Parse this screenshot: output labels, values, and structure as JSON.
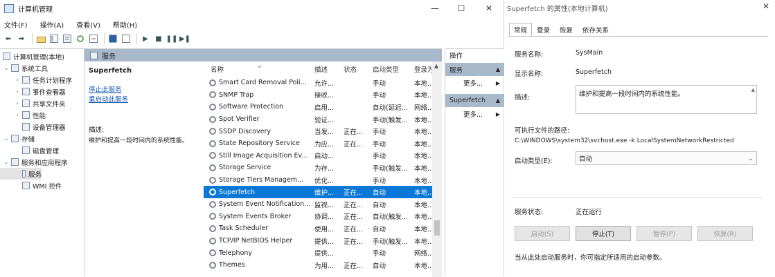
{
  "window": {
    "title": "计算机管理",
    "minimize": "—",
    "maximize": "☐",
    "close": "✕"
  },
  "menu": [
    "文件(F)",
    "操作(A)",
    "查看(V)",
    "帮助(H)"
  ],
  "toolbar": {
    "back": "⬅",
    "forward": "➡",
    "play": "▶",
    "stop": "■",
    "pause": "❚❚",
    "restart": "▶❚"
  },
  "tree": {
    "items": [
      {
        "label": "计算机管理(本地)",
        "arrow": "",
        "indent": 0
      },
      {
        "label": "系统工具",
        "arrow": "⌄",
        "indent": 1
      },
      {
        "label": "任务计划程序",
        "arrow": "›",
        "indent": 2
      },
      {
        "label": "事件查看器",
        "arrow": "›",
        "indent": 2
      },
      {
        "label": "共享文件夹",
        "arrow": "›",
        "indent": 2
      },
      {
        "label": "性能",
        "arrow": "›",
        "indent": 2
      },
      {
        "label": "设备管理器",
        "arrow": "",
        "indent": 2
      },
      {
        "label": "存储",
        "arrow": "⌄",
        "indent": 1
      },
      {
        "label": "磁盘管理",
        "arrow": "",
        "indent": 2
      },
      {
        "label": "服务和应用程序",
        "arrow": "⌄",
        "indent": 1
      },
      {
        "label": "服务",
        "arrow": "",
        "indent": 2
      },
      {
        "label": "WMI 控件",
        "arrow": "",
        "indent": 2
      }
    ]
  },
  "center": {
    "header": "服务",
    "selected_service": "Superfetch",
    "link_stop": "停止此服务",
    "link_restart": "重启动此服务",
    "desc_label": "描述:",
    "desc_text": "维护和提高一段时间内的系统性能。"
  },
  "grid": {
    "columns": [
      "名称",
      "描述",
      "状态",
      "启动类型",
      "登录为"
    ],
    "sort_arrow": "^",
    "rows": [
      [
        "Smart Card Removal Poli...",
        "允许...",
        "",
        "手动",
        "本地..."
      ],
      [
        "SNMP Trap",
        "接收...",
        "",
        "手动",
        "本地..."
      ],
      [
        "Software Protection",
        "启用...",
        "",
        "自动(延迟...",
        "网络..."
      ],
      [
        "Spot Verifier",
        "验证...",
        "",
        "手动(触发...",
        "本地..."
      ],
      [
        "SSDP Discovery",
        "当发...",
        "正在...",
        "手动",
        "本地..."
      ],
      [
        "State Repository Service",
        "为应...",
        "正在...",
        "手动",
        "本地..."
      ],
      [
        "Still Image Acquisition Ev...",
        "启动...",
        "",
        "手动",
        "本地..."
      ],
      [
        "Storage Service",
        "为存...",
        "",
        "手动(触发...",
        "本地..."
      ],
      [
        "Storage Tiers Managem...",
        "优化...",
        "",
        "手动",
        "本地..."
      ],
      [
        "Superfetch",
        "维护...",
        "正在...",
        "自动",
        "本地..."
      ],
      [
        "System Event Notification...",
        "监视...",
        "正在...",
        "自动",
        "本地..."
      ],
      [
        "System Events Broker",
        "协调...",
        "正在...",
        "自动(触发...",
        "本地..."
      ],
      [
        "Task Scheduler",
        "使用...",
        "正在...",
        "自动",
        "本地..."
      ],
      [
        "TCP/IP NetBIOS Helper",
        "提供...",
        "正在...",
        "手动(触发...",
        "本地..."
      ],
      [
        "Telephony",
        "提供...",
        "",
        "手动",
        "网络..."
      ],
      [
        "Themes",
        "为用...",
        "正在...",
        "自动",
        "本地..."
      ]
    ],
    "selected_index": 9
  },
  "actions": {
    "title": "操作",
    "section1": "服务",
    "section2": "Superfetch",
    "more": "更多...",
    "up": "▲",
    "right": "▶"
  },
  "props": {
    "title": "Superfetch 的属性(本地计算机)",
    "close": "✕",
    "tabs": [
      "常规",
      "登录",
      "恢复",
      "依存关系"
    ],
    "service_name_label": "服务名称:",
    "service_name": "SysMain",
    "display_name_label": "显示名称:",
    "display_name": "Superfetch",
    "desc_label": "描述:",
    "desc": "维护和提高一段时间内的系统性能。",
    "path_label": "可执行文件的路径:",
    "path": "C:\\WINDOWS\\system32\\svchost.exe -k LocalSystemNetworkRestricted",
    "startup_label": "启动类型(E):",
    "startup_value": "自动",
    "status_label": "服务状态:",
    "status_value": "正在运行",
    "btn_start": "启动(S)",
    "btn_stop": "停止(T)",
    "btn_pause": "暂停(P)",
    "btn_resume": "恢复(R)",
    "footer": "当从此处启动服务时，你可指定所适用的启动参数。",
    "chevron": "⌄"
  }
}
